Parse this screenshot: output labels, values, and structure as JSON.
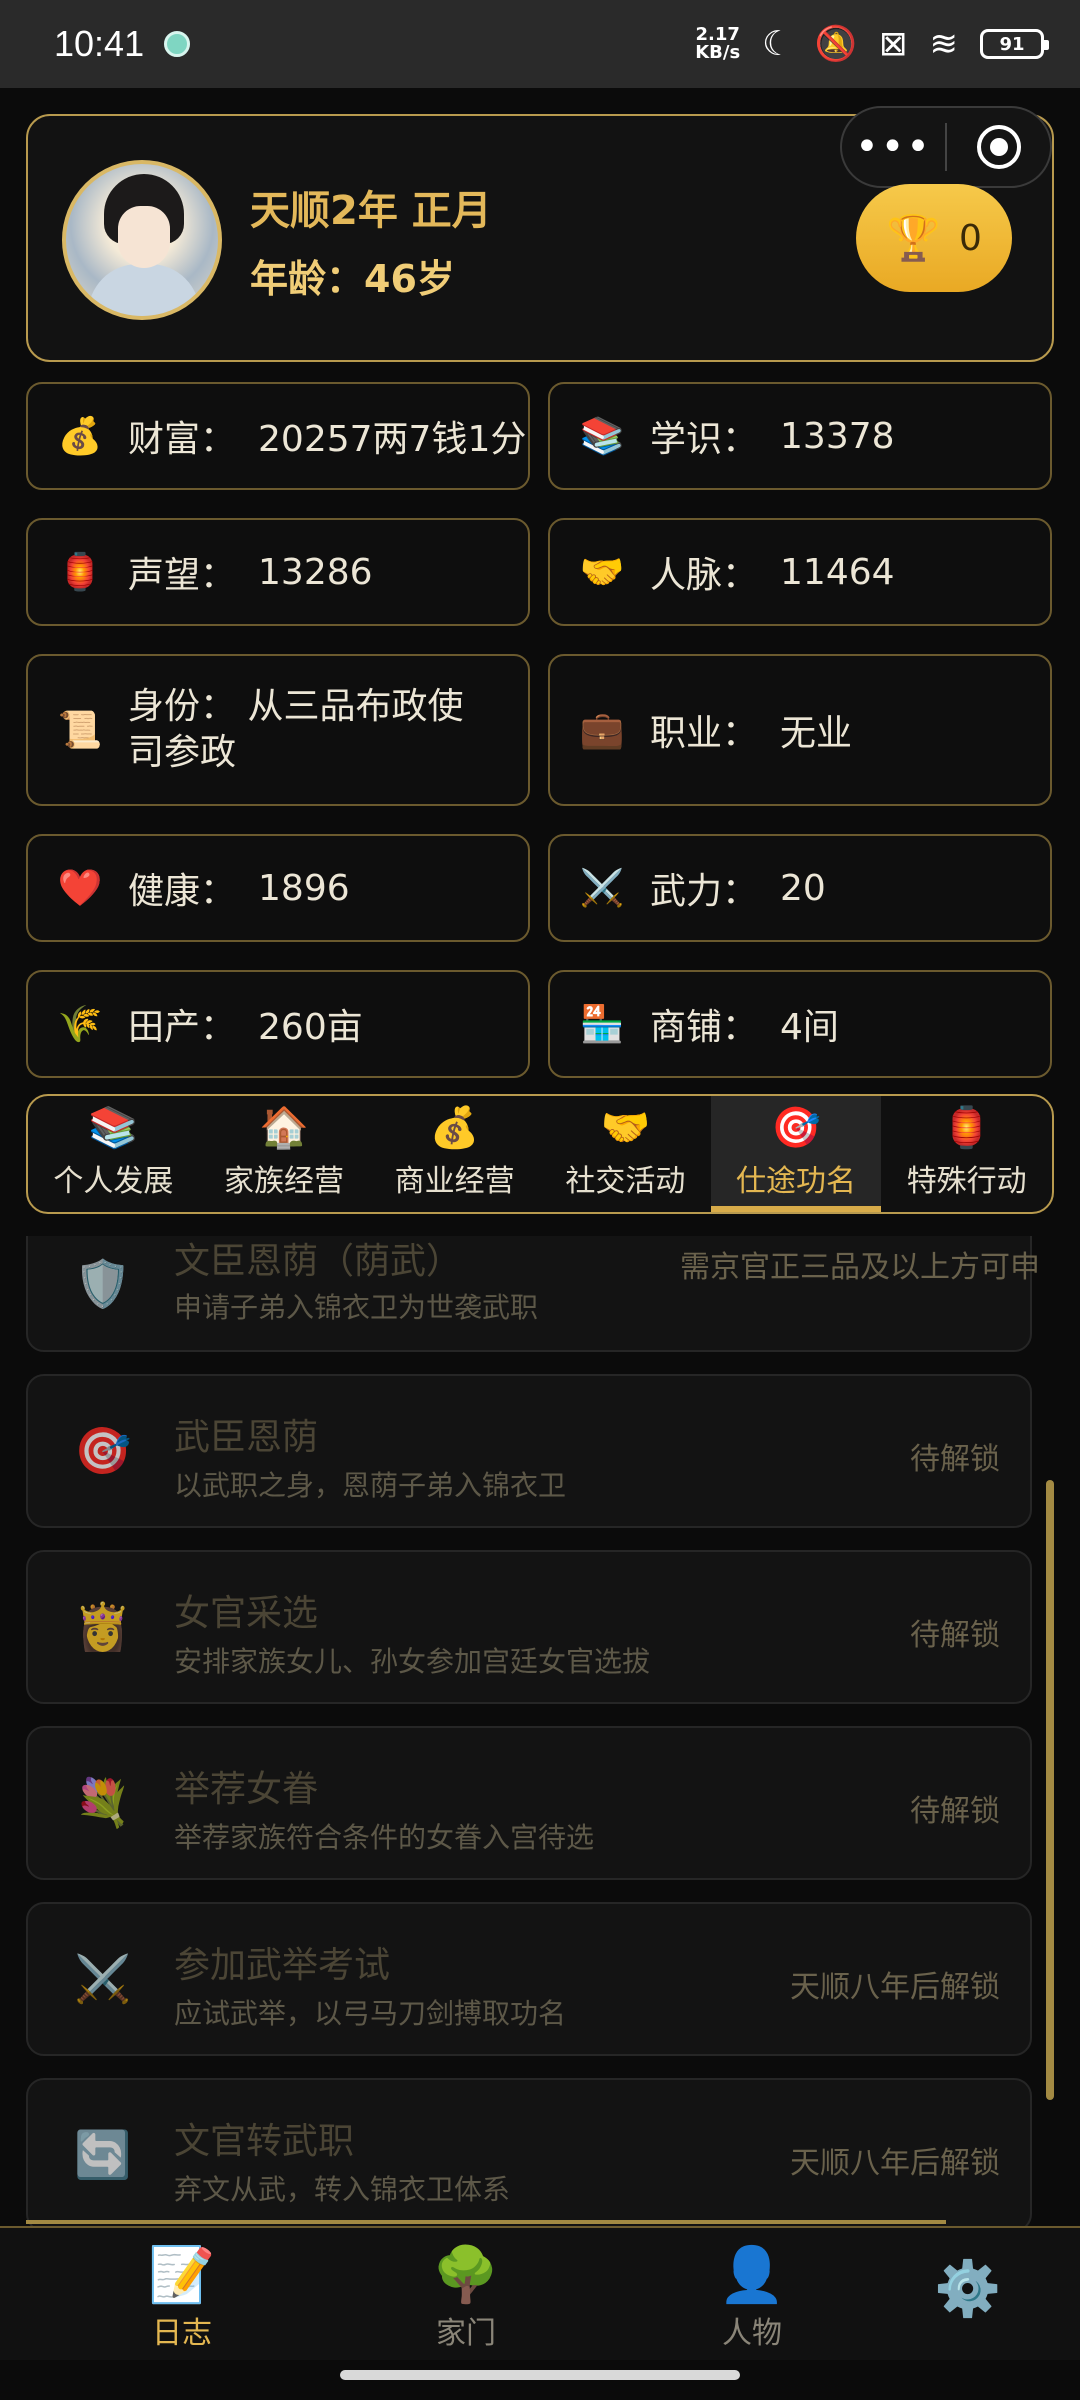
{
  "status_bar": {
    "time": "10:41",
    "net_speed_value": "2.17",
    "net_speed_unit": "KB/s",
    "battery": "91"
  },
  "profile": {
    "date": "天顺2年 正月",
    "age": "年龄：46岁",
    "trophy_count": "0"
  },
  "stats": {
    "wealth": {
      "icon": "💰",
      "label": "财富：",
      "value": "20257两7钱1分"
    },
    "knowledge": {
      "icon": "📚",
      "label": "学识：",
      "value": "13378"
    },
    "prestige": {
      "icon": "🏮",
      "label": "声望：",
      "value": "13286"
    },
    "connections": {
      "icon": "🤝",
      "label": "人脉：",
      "value": "11464"
    },
    "identity": {
      "icon": "📜",
      "text_line1": "身份：  从三品布政使",
      "text_line2": "司参政"
    },
    "occupation": {
      "icon": "💼",
      "label": "职业：",
      "value": "无业"
    },
    "health": {
      "icon": "❤️",
      "label": "健康：",
      "value": "1896"
    },
    "force": {
      "icon": "⚔️",
      "label": "武力：",
      "value": "20"
    },
    "land": {
      "icon": "🌾",
      "label": "田产：",
      "value": "260亩"
    },
    "shops": {
      "icon": "🏪",
      "label": "商铺：",
      "value": "4间"
    }
  },
  "tabs": [
    {
      "icon": "📚",
      "label": "个人发展"
    },
    {
      "icon": "🏠",
      "label": "家族经营"
    },
    {
      "icon": "💰",
      "label": "商业经营"
    },
    {
      "icon": "🤝",
      "label": "社交活动"
    },
    {
      "icon": "🎯",
      "label": "仕途功名"
    },
    {
      "icon": "🏮",
      "label": "特殊行动"
    }
  ],
  "actions": [
    {
      "icon": "🛡️",
      "title": "文臣恩荫（荫武）",
      "desc": "申请子弟入锦衣卫为世袭武职",
      "status": "需京官正三品及以上方可申"
    },
    {
      "icon": "🎯",
      "title": "武臣恩荫",
      "desc": "以武职之身，恩荫子弟入锦衣卫",
      "status": "待解锁"
    },
    {
      "icon": "👸",
      "title": "女官采选",
      "desc": "安排家族女儿、孙女参加宫廷女官选拔",
      "status": "待解锁"
    },
    {
      "icon": "💐",
      "title": "举荐女眷",
      "desc": "举荐家族符合条件的女眷入宫待选",
      "status": "待解锁"
    },
    {
      "icon": "⚔️",
      "title": "参加武举考试",
      "desc": "应试武举，以弓马刀剑搏取功名",
      "status": "天顺八年后解锁"
    },
    {
      "icon": "🔄",
      "title": "文官转武职",
      "desc": "弃文从武，转入锦衣卫体系",
      "status": "天顺八年后解锁"
    }
  ],
  "bottom_nav": [
    {
      "icon": "📝",
      "label": "日志"
    },
    {
      "icon": "🌳",
      "label": "家门"
    },
    {
      "icon": "👤",
      "label": "人物"
    },
    {
      "icon": "⚙️",
      "label": ""
    }
  ]
}
